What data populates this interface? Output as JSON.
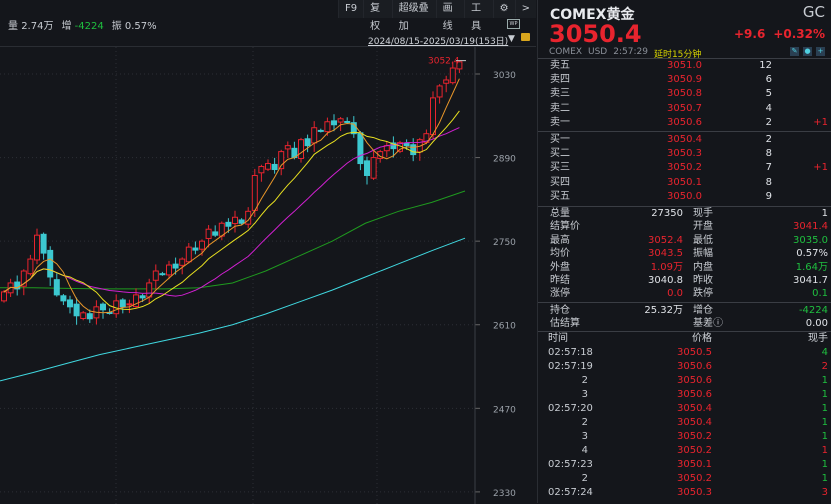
{
  "toolbar": {
    "items": [
      "F9",
      "复权",
      "超级叠加",
      "画线",
      "工具"
    ],
    "gear": "gear-icon",
    "more": ">"
  },
  "info": {
    "vol_label": "量",
    "vol": "2.74万",
    "inc_label": "增",
    "inc": "-4224",
    "amp_label": "振",
    "amp": "0.57%"
  },
  "range": "2024/08/15-2025/03/19(153日)",
  "axis": {
    "prices": [
      "3030",
      "2890",
      "2750",
      "2610",
      "2470",
      "2330"
    ],
    "high_marker": "3052.4"
  },
  "colors": {
    "up": "#e8242e",
    "down": "#3cc8d0",
    "ma5": "#e8962a",
    "ma10": "#e8e020",
    "ma20": "#d020d0",
    "ma60": "#1f9a1f",
    "ma120": "#40d8e0"
  },
  "chart_data": {
    "type": "candlestick",
    "ylim": [
      2300,
      3070
    ],
    "closes": [
      2665,
      2680,
      2670,
      2700,
      2720,
      2760,
      2730,
      2690,
      2660,
      2650,
      2640,
      2625,
      2630,
      2620,
      2640,
      2635,
      2630,
      2650,
      2640,
      2645,
      2660,
      2655,
      2680,
      2700,
      2695,
      2710,
      2705,
      2720,
      2740,
      2735,
      2750,
      2770,
      2760,
      2780,
      2775,
      2790,
      2780,
      2800,
      2860,
      2875,
      2880,
      2870,
      2900,
      2910,
      2890,
      2920,
      2910,
      2940,
      2935,
      2950,
      2945,
      2955,
      2950,
      2930,
      2880,
      2860,
      2890,
      2900,
      2910,
      2905,
      2915,
      2910,
      2895,
      2920,
      2930,
      2990,
      3010,
      3020,
      3040,
      3050.4
    ],
    "ma60": [
      2672,
      2672,
      2671,
      2670,
      2670,
      2670,
      2672,
      2680,
      2700,
      2725,
      2750,
      2780,
      2800,
      2815,
      2834
    ],
    "ma120": [
      2516,
      2530,
      2545,
      2560,
      2572,
      2584,
      2596,
      2610,
      2628,
      2648,
      2668,
      2690,
      2712,
      2734,
      2755
    ]
  },
  "quote": {
    "name": "COMEX黄金",
    "code": "GC",
    "price": "3050.4",
    "change": "+9.6",
    "pct": "+0.32%",
    "exch": "COMEX",
    "cur": "USD",
    "time": "2:57:29",
    "delay": "延时15分钟"
  },
  "asks": [
    {
      "l": "卖五",
      "p": "3051.0",
      "v": "12",
      "d": ""
    },
    {
      "l": "卖四",
      "p": "3050.9",
      "v": "6",
      "d": ""
    },
    {
      "l": "卖三",
      "p": "3050.8",
      "v": "5",
      "d": ""
    },
    {
      "l": "卖二",
      "p": "3050.7",
      "v": "4",
      "d": ""
    },
    {
      "l": "卖一",
      "p": "3050.6",
      "v": "2",
      "d": "+1"
    }
  ],
  "bids": [
    {
      "l": "买一",
      "p": "3050.4",
      "v": "2",
      "d": ""
    },
    {
      "l": "买二",
      "p": "3050.3",
      "v": "8",
      "d": ""
    },
    {
      "l": "买三",
      "p": "3050.2",
      "v": "7",
      "d": "+1"
    },
    {
      "l": "买四",
      "p": "3050.1",
      "v": "8",
      "d": ""
    },
    {
      "l": "买五",
      "p": "3050.0",
      "v": "9",
      "d": ""
    }
  ],
  "stats": [
    {
      "a": "总量",
      "b": "27350",
      "bc": "white",
      "c": "现手",
      "e": "1",
      "ec": "white"
    },
    {
      "a": "结算价",
      "b": "",
      "bc": "white",
      "c": "开盘",
      "e": "3041.4",
      "ec": "red"
    },
    {
      "a": "最高",
      "b": "3052.4",
      "bc": "red",
      "c": "最低",
      "e": "3035.0",
      "ec": "green"
    },
    {
      "a": "均价",
      "b": "3043.5",
      "bc": "red",
      "c": "振幅",
      "e": "0.57%",
      "ec": "white"
    },
    {
      "a": "外盘",
      "b": "1.09万",
      "bc": "red",
      "c": "内盘",
      "e": "1.64万",
      "ec": "green"
    },
    {
      "a": "昨结",
      "b": "3040.8",
      "bc": "white",
      "c": "昨收",
      "e": "3041.7",
      "ec": "white"
    },
    {
      "a": "涨停",
      "b": "0.0",
      "bc": "red",
      "c": "跌停",
      "e": "0.1",
      "ec": "green"
    },
    {
      "a": "持仓",
      "b": "25.32万",
      "bc": "white",
      "c": "增仓",
      "e": "-4224",
      "ec": "green"
    },
    {
      "a": "估结算",
      "b": "",
      "bc": "white",
      "c": "基差ⓘ",
      "e": "0.00",
      "ec": "white"
    }
  ],
  "ticks_header": {
    "time": "时间",
    "price": "价格",
    "vol": "现手"
  },
  "ticks": [
    {
      "t": "02:57:18",
      "p": "3050.5",
      "v": "4",
      "vc": "green"
    },
    {
      "t": "02:57:19",
      "p": "3050.6",
      "v": "2",
      "vc": "red"
    },
    {
      "t": "2",
      "p": "3050.6",
      "v": "1",
      "vc": "green"
    },
    {
      "t": "3",
      "p": "3050.6",
      "v": "1",
      "vc": "green"
    },
    {
      "t": "02:57:20",
      "p": "3050.4",
      "v": "1",
      "vc": "green"
    },
    {
      "t": "2",
      "p": "3050.4",
      "v": "1",
      "vc": "green"
    },
    {
      "t": "3",
      "p": "3050.2",
      "v": "1",
      "vc": "green"
    },
    {
      "t": "4",
      "p": "3050.2",
      "v": "1",
      "vc": "red"
    },
    {
      "t": "02:57:23",
      "p": "3050.1",
      "v": "1",
      "vc": "green"
    },
    {
      "t": "2",
      "p": "3050.2",
      "v": "1",
      "vc": "green"
    },
    {
      "t": "02:57:24",
      "p": "3050.3",
      "v": "3",
      "vc": "red"
    }
  ]
}
